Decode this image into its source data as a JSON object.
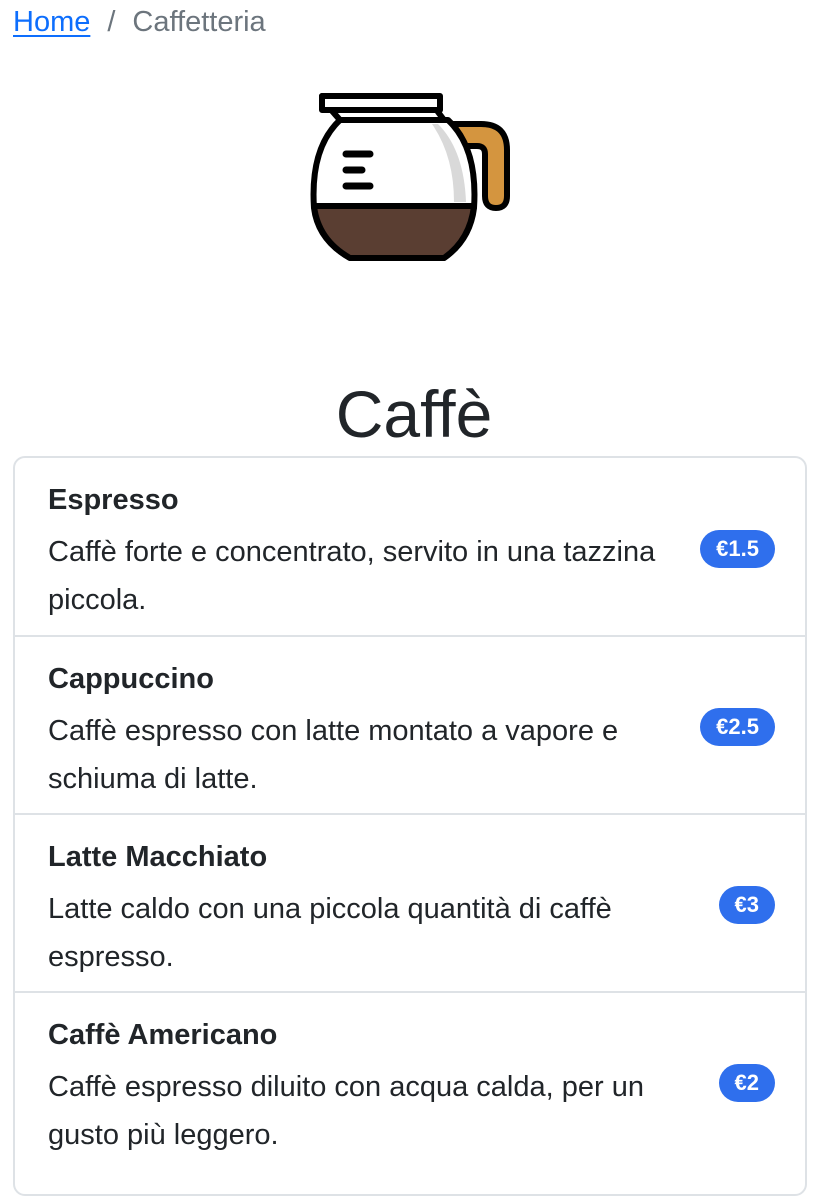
{
  "breadcrumb": {
    "home": "Home",
    "separator": "/",
    "current": "Caffetteria"
  },
  "hero": {
    "icon": "coffee-pot-icon"
  },
  "title": "Caffè",
  "colors": {
    "link": "#0d6efd",
    "badge": "#2f6fed",
    "coffee": "#5a3e32",
    "handle": "#d4953f",
    "border": "#dee2e6"
  },
  "items": [
    {
      "name": "Espresso",
      "description": "Caffè forte e concentrato, servito in una tazzina piccola.",
      "price": "€1.5"
    },
    {
      "name": "Cappuccino",
      "description": "Caffè espresso con latte montato a vapore e schiuma di latte.",
      "price": "€2.5"
    },
    {
      "name": "Latte Macchiato",
      "description": "Latte caldo con una piccola quantità di caffè espresso.",
      "price": "€3"
    },
    {
      "name": "Caffè Americano",
      "description": "Caffè espresso diluito con acqua calda, per un gusto più leggero.",
      "price": "€2"
    }
  ]
}
